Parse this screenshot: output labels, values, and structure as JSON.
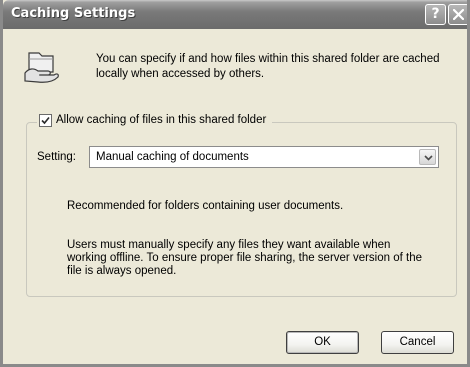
{
  "window": {
    "title": "Caching Settings",
    "help_glyph": "?",
    "close_icon": "close-icon"
  },
  "info": {
    "icon": "shared-folder-hand-icon",
    "text": "You can specify if and how files within this shared folder are cached locally when accessed by others."
  },
  "allow_caching": {
    "label": "Allow caching of files in this shared folder",
    "checked": true
  },
  "setting": {
    "label": "Setting:",
    "selected": "Manual caching of documents"
  },
  "description": {
    "recommend": "Recommended for folders containing user documents.",
    "detail": "Users must manually specify any files they want available when working offline.  To ensure proper file sharing, the server version of the file is always opened."
  },
  "buttons": {
    "ok": "OK",
    "cancel": "Cancel"
  }
}
